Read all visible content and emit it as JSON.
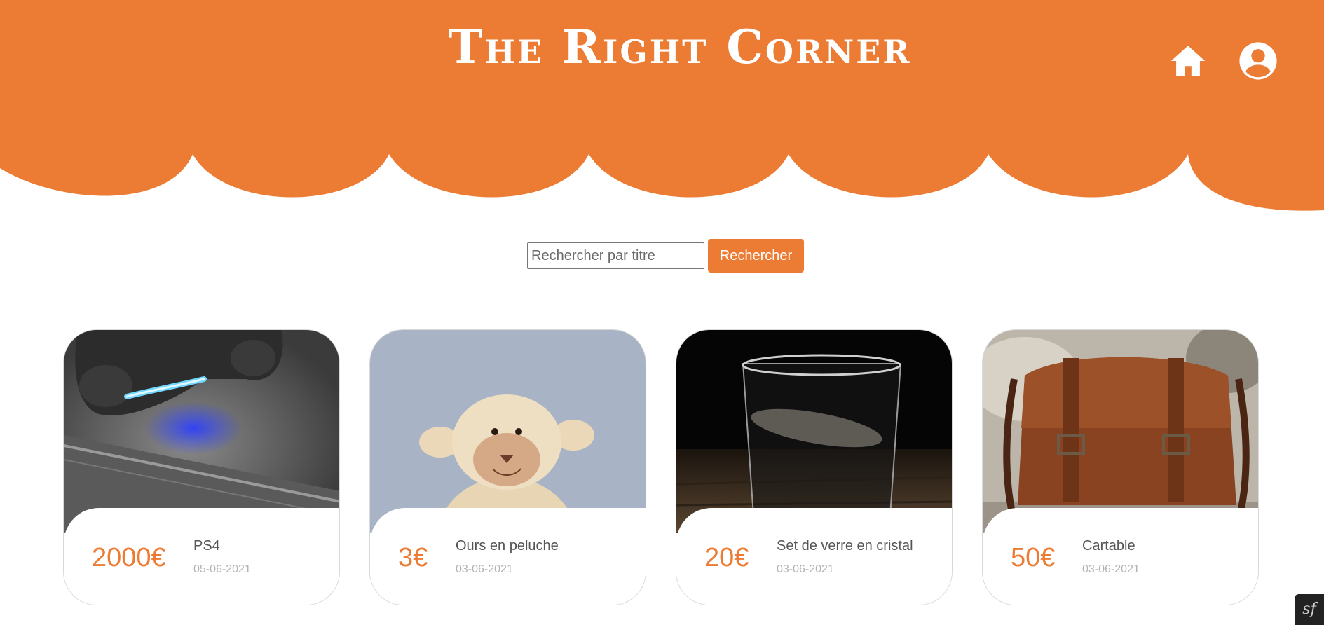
{
  "header": {
    "title": "The Right Corner",
    "brand_color": "#ec7b33",
    "home_icon": "home-icon",
    "user_icon": "account-circle-icon"
  },
  "search": {
    "placeholder": "Rechercher par titre",
    "value": "",
    "button_label": "Rechercher"
  },
  "cards": [
    {
      "price": "2000€",
      "title": "PS4",
      "date": "05-06-2021",
      "image": "playstation-controller"
    },
    {
      "price": "3€",
      "title": "Ours en peluche",
      "date": "03-06-2021",
      "image": "plush-sheep"
    },
    {
      "price": "20€",
      "title": "Set de verre en cristal",
      "date": "03-06-2021",
      "image": "water-glass"
    },
    {
      "price": "50€",
      "title": "Cartable",
      "date": "03-06-2021",
      "image": "leather-bag"
    }
  ],
  "footer": {
    "toolbar_label": "sf"
  }
}
